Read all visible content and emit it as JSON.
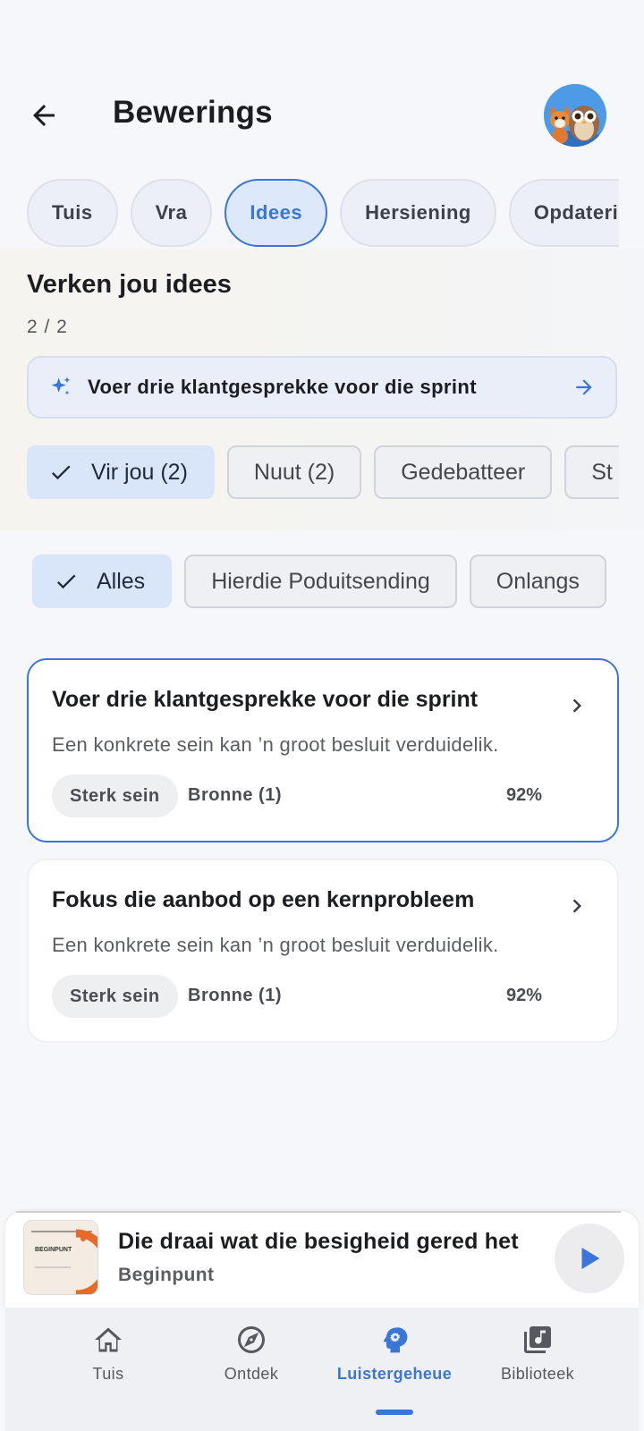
{
  "header": {
    "title": "Bewerings"
  },
  "tabs": [
    {
      "label": "Tuis"
    },
    {
      "label": "Vra"
    },
    {
      "label": "Idees",
      "active": true
    },
    {
      "label": "Hersiening"
    },
    {
      "label": "Opdaterin"
    }
  ],
  "explore": {
    "title": "Verken jou idees",
    "count": "2 / 2",
    "banner_text": "Voer drie klantgesprekke voor die sprint"
  },
  "filter_chips_1": [
    {
      "label": "Vir jou (2)",
      "selected": true
    },
    {
      "label": "Nuut (2)"
    },
    {
      "label": "Gedebatteer"
    },
    {
      "label": "St"
    }
  ],
  "filter_chips_2": [
    {
      "label": "Alles",
      "selected": true
    },
    {
      "label": "Hierdie Poduitsending"
    },
    {
      "label": "Onlangs"
    }
  ],
  "cards": [
    {
      "title": "Voer drie klantgesprekke voor die sprint",
      "description": "Een konkrete sein kan ’n groot besluit verduidelik.",
      "badge": "Sterk sein",
      "sources": "Bronne (1)",
      "percent": "92%"
    },
    {
      "title": "Fokus die aanbod op een kernprobleem",
      "description": "Een konkrete sein kan ’n groot besluit verduidelik.",
      "badge": "Sterk sein",
      "sources": "Bronne (1)",
      "percent": "92%"
    }
  ],
  "player": {
    "title": "Die draai wat die besigheid gered het",
    "subtitle": "Beginpunt",
    "cover_text": "BEGINPUNT"
  },
  "nav": [
    {
      "label": "Tuis",
      "icon": "home-icon"
    },
    {
      "label": "Ontdek",
      "icon": "compass-icon"
    },
    {
      "label": "Luistergeheue",
      "icon": "brain-icon",
      "active": true
    },
    {
      "label": "Biblioteek",
      "icon": "library-icon"
    }
  ],
  "colors": {
    "accent": "#3a76d8",
    "background": "#f5f7fa"
  }
}
